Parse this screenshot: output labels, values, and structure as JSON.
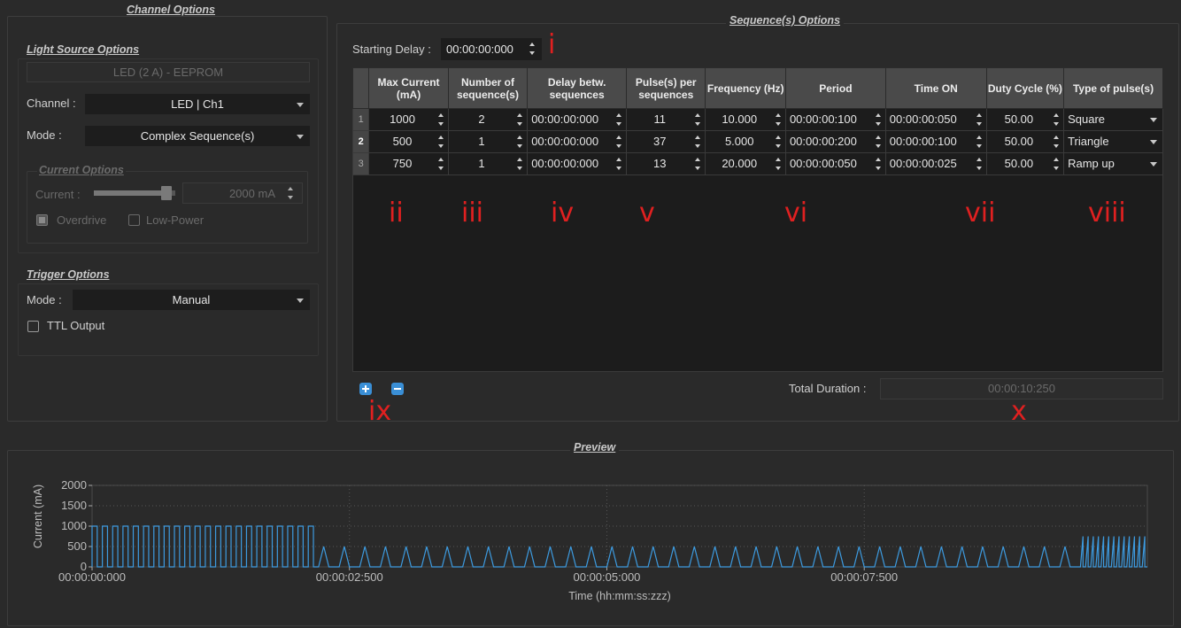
{
  "channel_options": {
    "title": "Channel Options",
    "light_source": {
      "title": "Light Source Options",
      "source_name": "LED (2 A) - EEPROM",
      "channel_label": "Channel :",
      "channel_value": "LED | Ch1",
      "mode_label": "Mode :",
      "mode_value": "Complex Sequence(s)",
      "current_options": {
        "title": "Current Options",
        "current_label": "Current :",
        "current_value": "2000 mA",
        "current_fraction": 1.0,
        "overdrive_label": "Overdrive",
        "overdrive_checked": true,
        "lowpower_label": "Low-Power",
        "lowpower_checked": false
      }
    },
    "trigger": {
      "title": "Trigger Options",
      "mode_label": "Mode :",
      "mode_value": "Manual",
      "ttl_label": "TTL Output",
      "ttl_checked": false
    }
  },
  "sequence_options": {
    "title": "Sequence(s) Options",
    "starting_delay_label": "Starting Delay :",
    "starting_delay_value": "00:00:00:000",
    "columns": [
      "Max Current (mA)",
      "Number of sequence(s)",
      "Delay betw. sequences",
      "Pulse(s) per sequences",
      "Frequency (Hz)",
      "Period",
      "Time ON",
      "Duty Cycle (%)",
      "Type of pulse(s)"
    ],
    "rows": [
      {
        "num": "1",
        "max_current": "1000",
        "num_seq": "2",
        "delay": "00:00:00:000",
        "pulses": "11",
        "freq": "10.000",
        "period": "00:00:00:100",
        "time_on": "00:00:00:050",
        "duty": "50.00",
        "type": "Square"
      },
      {
        "num": "2",
        "max_current": "500",
        "num_seq": "1",
        "delay": "00:00:00:000",
        "pulses": "37",
        "freq": "5.000",
        "period": "00:00:00:200",
        "time_on": "00:00:00:100",
        "duty": "50.00",
        "type": "Triangle"
      },
      {
        "num": "3",
        "max_current": "750",
        "num_seq": "1",
        "delay": "00:00:00:000",
        "pulses": "13",
        "freq": "20.000",
        "period": "00:00:00:050",
        "time_on": "00:00:00:025",
        "duty": "50.00",
        "type": "Ramp up"
      }
    ],
    "total_duration_label": "Total Duration :",
    "total_duration_value": "00:00:10:250"
  },
  "annotations": {
    "i": "i",
    "ii": "ii",
    "iii": "iii",
    "iv": "iv",
    "v": "v",
    "vi": "vi",
    "vii": "vii",
    "viii": "viii",
    "ix": "ix",
    "x": "x",
    "color": "#e02020"
  },
  "preview": {
    "title": "Preview",
    "chart_data": {
      "type": "line",
      "ylabel": "Current (mA)",
      "xlabel": "Time (hh:mm:ss:zzz)",
      "ylim": [
        0,
        2000
      ],
      "yticks": [
        "2000",
        "1500",
        "1000",
        "500",
        "0"
      ],
      "xticks": [
        "00:00:00:000",
        "00:00:02:500",
        "00:00:05:000",
        "00:00:07:500"
      ],
      "xlim_ms": [
        0,
        10250
      ],
      "series": [
        {
          "shape": "square",
          "amplitude": 1000,
          "start_ms": 0,
          "period_ms": 100,
          "on_ms": 50,
          "count": 22
        },
        {
          "shape": "triangle",
          "amplitude": 500,
          "start_ms": 2200,
          "period_ms": 200,
          "on_ms": 100,
          "count": 37
        },
        {
          "shape": "ramp",
          "amplitude": 750,
          "start_ms": 9600,
          "period_ms": 50,
          "on_ms": 25,
          "count": 13
        }
      ],
      "line_color": "#3d9be0",
      "grid": true
    }
  }
}
